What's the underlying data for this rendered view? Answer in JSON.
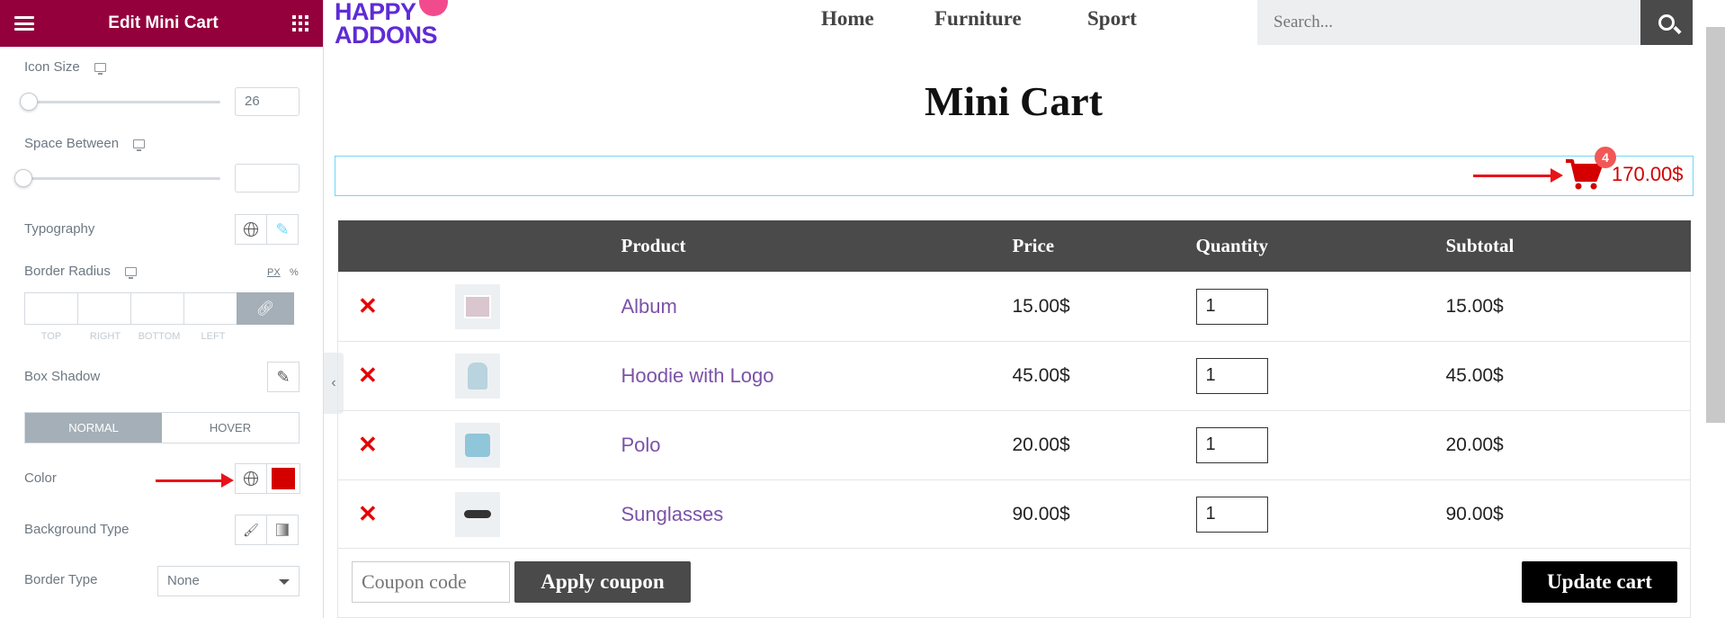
{
  "sidebar": {
    "title": "Edit Mini Cart",
    "icon_size": {
      "label": "Icon Size",
      "value": "26",
      "level": 0.0
    },
    "space_between": {
      "label": "Space Between",
      "value": "",
      "level": 0.0
    },
    "typography": {
      "label": "Typography"
    },
    "border_radius": {
      "label": "Border Radius",
      "unit_px": "PX",
      "unit_pct": "%",
      "sides": [
        "TOP",
        "RIGHT",
        "BOTTOM",
        "LEFT"
      ]
    },
    "box_shadow": {
      "label": "Box Shadow"
    },
    "tabs": {
      "normal": "NORMAL",
      "hover": "HOVER"
    },
    "color": {
      "label": "Color",
      "value": "#d40000"
    },
    "background_type": {
      "label": "Background Type"
    },
    "border_type": {
      "label": "Border Type",
      "value": "None"
    }
  },
  "site": {
    "logo": {
      "line1": "HAPPY",
      "line2": "ADDONS"
    },
    "nav": [
      "Home",
      "Furniture",
      "Sport"
    ],
    "search": {
      "placeholder": "Search..."
    },
    "page_title": "Mini Cart"
  },
  "mini_cart": {
    "count": "4",
    "total": "170.00$",
    "color": "#d40000"
  },
  "cart": {
    "headers": {
      "product": "Product",
      "price": "Price",
      "quantity": "Quantity",
      "subtotal": "Subtotal"
    },
    "items": [
      {
        "name": "Album",
        "price": "15.00$",
        "qty": "1",
        "subtotal": "15.00$",
        "thumb_icon": "album-icon"
      },
      {
        "name": "Hoodie with Logo",
        "price": "45.00$",
        "qty": "1",
        "subtotal": "45.00$",
        "thumb_icon": "hoodie-icon"
      },
      {
        "name": "Polo",
        "price": "20.00$",
        "qty": "1",
        "subtotal": "20.00$",
        "thumb_icon": "polo-shirt-icon"
      },
      {
        "name": "Sunglasses",
        "price": "90.00$",
        "qty": "1",
        "subtotal": "90.00$",
        "thumb_icon": "sunglasses-icon"
      }
    ],
    "coupon_placeholder": "Coupon code",
    "apply_label": "Apply coupon",
    "update_label": "Update cart"
  }
}
